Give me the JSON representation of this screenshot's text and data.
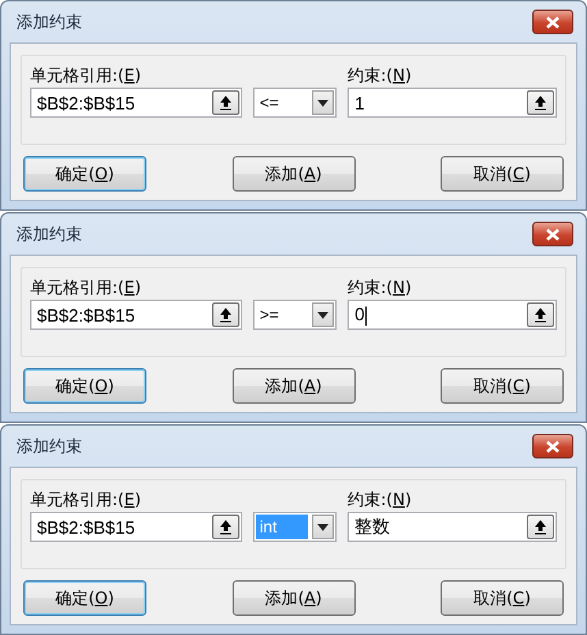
{
  "dialogs": [
    {
      "title": "添加约束",
      "cell_ref": {
        "label": [
          "单元格引用:(",
          "E",
          ")"
        ],
        "value": "$B$2:$B$15"
      },
      "operator": {
        "value": "<=",
        "highlighted": false
      },
      "constraint": {
        "label": [
          "约束:(",
          "N",
          ")"
        ],
        "value": "1",
        "focused": false
      },
      "buttons": [
        {
          "label": [
            "确定(",
            "O",
            ")"
          ],
          "default": true
        },
        {
          "label": [
            "添加(",
            "A",
            ")"
          ],
          "default": false
        },
        {
          "label": [
            "取消(",
            "C",
            ")"
          ],
          "default": false
        }
      ]
    },
    {
      "title": "添加约束",
      "cell_ref": {
        "label": [
          "单元格引用:(",
          "E",
          ")"
        ],
        "value": "$B$2:$B$15"
      },
      "operator": {
        "value": ">=",
        "highlighted": false
      },
      "constraint": {
        "label": [
          "约束:(",
          "N",
          ")"
        ],
        "value": "0",
        "focused": true
      },
      "buttons": [
        {
          "label": [
            "确定(",
            "O",
            ")"
          ],
          "default": true
        },
        {
          "label": [
            "添加(",
            "A",
            ")"
          ],
          "default": false
        },
        {
          "label": [
            "取消(",
            "C",
            ")"
          ],
          "default": false
        }
      ]
    },
    {
      "title": "添加约束",
      "cell_ref": {
        "label": [
          "单元格引用:(",
          "E",
          ")"
        ],
        "value": "$B$2:$B$15"
      },
      "operator": {
        "value": "int",
        "highlighted": true
      },
      "constraint": {
        "label": [
          "约束:(",
          "N",
          ")"
        ],
        "value": "整数",
        "focused": false
      },
      "buttons": [
        {
          "label": [
            "确定(",
            "O",
            ")"
          ],
          "default": true
        },
        {
          "label": [
            "添加(",
            "A",
            ")"
          ],
          "default": false
        },
        {
          "label": [
            "取消(",
            "C",
            ")"
          ],
          "default": false
        }
      ]
    }
  ]
}
